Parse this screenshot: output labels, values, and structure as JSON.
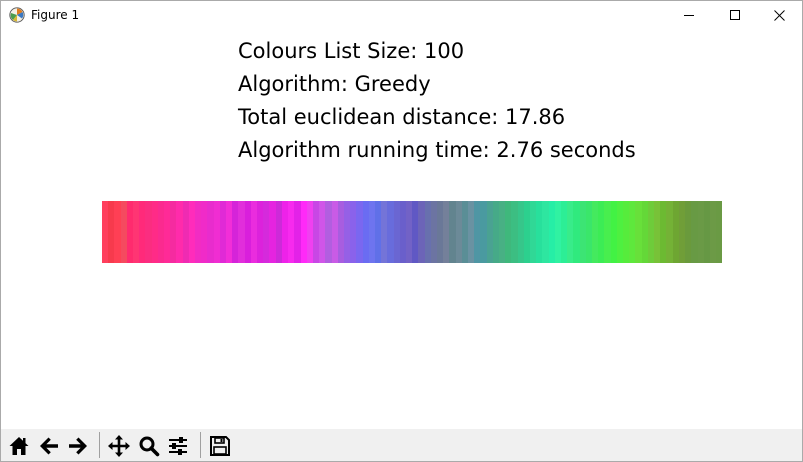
{
  "window": {
    "title": "Figure 1",
    "icon": "matplotlib-icon",
    "controls": [
      "minimize-icon",
      "maximize-icon",
      "close-icon"
    ]
  },
  "figure": {
    "info_lines": [
      "Colours List Size: 100",
      "Algorithm: Greedy",
      "Total euclidean distance: 17.86",
      "Algorithm running time: 2.76  seconds"
    ],
    "colour_strip": [
      "#ff3f5d",
      "#f73a4d",
      "#ff3f55",
      "#f54a5f",
      "#ff2b6e",
      "#ff3573",
      "#ff2a7a",
      "#fb2d80",
      "#ff2b87",
      "#fb2a8f",
      "#ff2a97",
      "#f52ba0",
      "#ff2bab",
      "#ef2bb2",
      "#ff2cbb",
      "#f22cc3",
      "#f02bc8",
      "#e82ccd",
      "#f02dd2",
      "#e02ad6",
      "#f22ed8",
      "#d524d9",
      "#e12edb",
      "#d91fdc",
      "#ea2cde",
      "#dc22dc",
      "#d52adc",
      "#e524e0",
      "#cd2ad9",
      "#ee22e9",
      "#f72aee",
      "#e322e8",
      "#ff2af8",
      "#f040f0",
      "#c847e5",
      "#d055e8",
      "#b25ee0",
      "#c95be6",
      "#a85de0",
      "#9560e6",
      "#8a62eb",
      "#7a67f0",
      "#6a6cf2",
      "#6e74ef",
      "#6070e8",
      "#7474d8",
      "#686cdc",
      "#6a66d2",
      "#6a5fcb",
      "#7262c6",
      "#6058c4",
      "#6c64b8",
      "#6870ae",
      "#6c74a2",
      "#6a7898",
      "#74809a",
      "#62848f",
      "#6c8a98",
      "#5a8e96",
      "#6a92a2",
      "#4f96a4",
      "#4a9aa0",
      "#4aa292",
      "#46aa88",
      "#48b084",
      "#3fb87c",
      "#3cbe82",
      "#36c68a",
      "#2cd08e",
      "#30d896",
      "#28e09c",
      "#2ee6a0",
      "#26eea6",
      "#30f2a2",
      "#2cee96",
      "#38ec8a",
      "#30ea7e",
      "#3ce474",
      "#3ae66a",
      "#44ea5e",
      "#3cec55",
      "#48ee4e",
      "#42f244",
      "#4ef040",
      "#56ec3c",
      "#5ee83c",
      "#68e03a",
      "#64d838",
      "#6ecc3a",
      "#78c238",
      "#6cba32",
      "#74b236",
      "#6ea632",
      "#709e38",
      "#6a9a3c",
      "#689a44",
      "#6a9a46",
      "#669844",
      "#6c9a46",
      "#6a9a44"
    ]
  },
  "toolbar": {
    "tools": [
      "home-icon",
      "back-icon",
      "forward-icon",
      "pan-icon",
      "zoom-icon",
      "configure-subplots-icon",
      "save-icon"
    ]
  },
  "colors": {
    "window_border": "#aaaaaa",
    "toolbar_bg": "#f0f0f0",
    "text": "#000000"
  }
}
